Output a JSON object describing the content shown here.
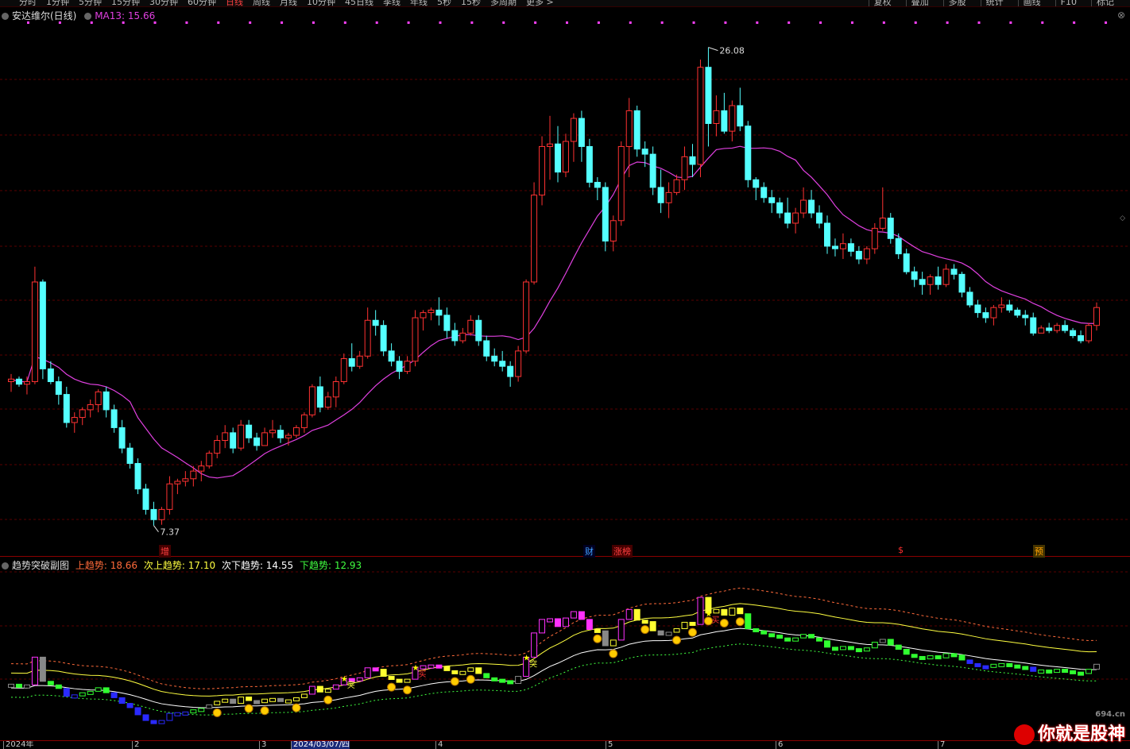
{
  "toolbar": {
    "periods": [
      "分时",
      "1分钟",
      "5分钟",
      "15分钟",
      "30分钟",
      "60分钟",
      "日线",
      "周线",
      "月线",
      "10分钟",
      "45日线",
      "季线",
      "年线",
      "5秒",
      "15秒",
      "多周期",
      "更多 >"
    ],
    "active_period": "日线",
    "right_buttons": [
      "复权",
      "叠加",
      "多股",
      "统计",
      "画线",
      "F10",
      "标记"
    ]
  },
  "main_panel": {
    "stock_name": "安达维尔(日线)",
    "ma_label": "MA13: 15.66",
    "high_label": "26.08",
    "low_label": "7.37"
  },
  "markers": [
    {
      "text": "增",
      "color": "#ff4040",
      "bg": "#400"
    },
    {
      "text": "财",
      "color": "#40a0ff",
      "bg": "#002"
    },
    {
      "text": "涨榜",
      "color": "#ff4040",
      "bg": "#400"
    },
    {
      "text": "$",
      "color": "#ff3030",
      "bg": "#000"
    },
    {
      "text": "预",
      "color": "#ffa000",
      "bg": "#430"
    }
  ],
  "sub_panel": {
    "name": "趋势突破副图",
    "up_label": "上趋势: 18.66",
    "up_color": "#ff6a3a",
    "sub_up_label": "次上趋势: 17.10",
    "sub_up_color": "#ffff40",
    "sub_down_label": "次下趋势: 14.55",
    "sub_down_color": "#ffffff",
    "down_label": "下趋势: 12.93",
    "down_color": "#40ff40",
    "signal_texts": [
      "突",
      "买"
    ]
  },
  "x_axis": {
    "labels": [
      "2024年",
      "2",
      "3",
      "2024/03/07/四",
      "4",
      "5",
      "6",
      "7"
    ],
    "selected": "2024/03/07/四"
  },
  "watermark": {
    "url": "694.cn",
    "text": "你就是股神"
  },
  "colors": {
    "up": "#ff3232",
    "down": "#54ffff",
    "ma": "#e040e0",
    "grid": "#5a0000"
  },
  "chart_data": {
    "type": "candlestick",
    "ma_period": 13,
    "candles": [
      [
        13.0,
        13.3,
        12.6,
        13.1
      ],
      [
        13.1,
        13.2,
        12.8,
        12.9
      ],
      [
        12.9,
        13.2,
        12.5,
        13.0
      ],
      [
        13.0,
        17.5,
        12.9,
        16.9
      ],
      [
        16.9,
        17.0,
        13.1,
        13.5
      ],
      [
        13.5,
        13.8,
        12.9,
        13.0
      ],
      [
        13.0,
        13.2,
        12.1,
        12.5
      ],
      [
        12.5,
        12.8,
        11.2,
        11.4
      ],
      [
        11.4,
        11.8,
        11.0,
        11.6
      ],
      [
        11.6,
        12.0,
        11.3,
        11.9
      ],
      [
        11.9,
        12.3,
        11.6,
        12.1
      ],
      [
        12.1,
        12.7,
        11.8,
        12.6
      ],
      [
        12.6,
        12.8,
        11.6,
        11.9
      ],
      [
        11.9,
        12.1,
        11.0,
        11.2
      ],
      [
        11.2,
        11.5,
        10.2,
        10.4
      ],
      [
        10.4,
        10.6,
        9.6,
        9.8
      ],
      [
        9.8,
        10.0,
        8.6,
        8.8
      ],
      [
        8.8,
        9.0,
        7.8,
        8.0
      ],
      [
        8.0,
        8.3,
        7.37,
        7.6
      ],
      [
        7.6,
        8.1,
        7.4,
        8.0
      ],
      [
        8.0,
        9.3,
        7.8,
        9.0
      ],
      [
        9.0,
        9.2,
        8.6,
        9.1
      ],
      [
        9.1,
        9.5,
        8.9,
        9.2
      ],
      [
        9.2,
        9.7,
        8.9,
        9.5
      ],
      [
        9.5,
        9.9,
        9.1,
        9.7
      ],
      [
        9.7,
        10.3,
        9.6,
        10.2
      ],
      [
        10.2,
        10.9,
        10.0,
        10.7
      ],
      [
        10.7,
        11.3,
        10.4,
        11.0
      ],
      [
        11.0,
        11.2,
        10.2,
        10.4
      ],
      [
        10.4,
        11.5,
        10.3,
        11.3
      ],
      [
        11.3,
        11.5,
        10.6,
        10.8
      ],
      [
        10.8,
        11.0,
        10.3,
        10.5
      ],
      [
        10.5,
        11.2,
        10.5,
        11.0
      ],
      [
        11.0,
        11.5,
        10.8,
        11.1
      ],
      [
        11.1,
        11.3,
        10.6,
        10.8
      ],
      [
        10.8,
        11.0,
        10.5,
        10.9
      ],
      [
        10.9,
        11.3,
        10.8,
        11.2
      ],
      [
        11.2,
        11.8,
        11.0,
        11.7
      ],
      [
        11.7,
        12.9,
        11.6,
        12.8
      ],
      [
        12.8,
        13.2,
        11.8,
        12.0
      ],
      [
        12.0,
        12.6,
        11.9,
        12.4
      ],
      [
        12.4,
        13.2,
        12.0,
        13.0
      ],
      [
        13.0,
        14.1,
        12.9,
        13.9
      ],
      [
        13.9,
        14.5,
        13.4,
        13.6
      ],
      [
        13.6,
        14.2,
        13.5,
        14.0
      ],
      [
        14.0,
        15.9,
        13.9,
        15.4
      ],
      [
        15.4,
        15.8,
        14.8,
        15.2
      ],
      [
        15.2,
        15.4,
        14.0,
        14.2
      ],
      [
        14.2,
        14.5,
        13.6,
        13.8
      ],
      [
        13.8,
        14.0,
        13.1,
        13.4
      ],
      [
        13.4,
        14.0,
        13.3,
        13.8
      ],
      [
        13.8,
        15.8,
        13.6,
        15.5
      ],
      [
        15.5,
        15.8,
        15.0,
        15.7
      ],
      [
        15.7,
        15.9,
        15.4,
        15.8
      ],
      [
        15.8,
        16.3,
        15.2,
        15.6
      ],
      [
        15.6,
        15.9,
        14.7,
        15.0
      ],
      [
        15.0,
        15.3,
        14.4,
        14.6
      ],
      [
        14.6,
        15.1,
        14.5,
        14.9
      ],
      [
        14.9,
        15.6,
        14.8,
        15.4
      ],
      [
        15.4,
        15.6,
        14.4,
        14.6
      ],
      [
        14.6,
        14.8,
        13.8,
        14.0
      ],
      [
        14.0,
        14.3,
        13.6,
        13.8
      ],
      [
        13.8,
        14.2,
        13.4,
        13.6
      ],
      [
        13.6,
        13.8,
        12.8,
        13.2
      ],
      [
        13.2,
        14.4,
        13.0,
        14.2
      ],
      [
        14.2,
        17.0,
        14.1,
        16.9
      ],
      [
        16.9,
        20.8,
        16.8,
        20.3
      ],
      [
        20.3,
        22.6,
        19.9,
        22.2
      ],
      [
        22.2,
        23.4,
        20.9,
        22.3
      ],
      [
        22.3,
        23.0,
        20.8,
        21.2
      ],
      [
        21.2,
        22.7,
        21.0,
        22.4
      ],
      [
        22.4,
        23.5,
        21.6,
        23.3
      ],
      [
        23.3,
        23.6,
        21.6,
        22.2
      ],
      [
        22.2,
        22.5,
        20.6,
        20.8
      ],
      [
        20.8,
        21.0,
        20.1,
        20.6
      ],
      [
        20.6,
        20.8,
        18.1,
        18.5
      ],
      [
        18.5,
        19.5,
        18.1,
        19.3
      ],
      [
        19.3,
        22.4,
        19.1,
        22.2
      ],
      [
        22.2,
        24.1,
        21.0,
        23.6
      ],
      [
        23.6,
        23.8,
        21.8,
        22.1
      ],
      [
        22.1,
        22.4,
        21.4,
        21.9
      ],
      [
        21.9,
        22.2,
        20.3,
        20.6
      ],
      [
        20.6,
        21.3,
        19.6,
        20.0
      ],
      [
        20.0,
        20.8,
        19.4,
        20.4
      ],
      [
        20.4,
        21.1,
        20.3,
        20.9
      ],
      [
        20.9,
        22.2,
        20.5,
        21.8
      ],
      [
        21.8,
        22.3,
        21.0,
        21.5
      ],
      [
        21.5,
        25.6,
        21.0,
        25.3
      ],
      [
        25.3,
        26.08,
        22.2,
        23.1
      ],
      [
        23.1,
        24.2,
        22.6,
        23.6
      ],
      [
        23.6,
        24.3,
        22.7,
        22.8
      ],
      [
        22.8,
        24.0,
        22.4,
        23.8
      ],
      [
        23.8,
        24.5,
        22.8,
        23.0
      ],
      [
        23.0,
        23.2,
        20.6,
        20.9
      ],
      [
        20.9,
        21.0,
        20.1,
        20.6
      ],
      [
        20.6,
        20.8,
        20.0,
        20.2
      ],
      [
        20.2,
        20.5,
        19.6,
        20.0
      ],
      [
        20.0,
        20.2,
        19.4,
        19.6
      ],
      [
        19.6,
        20.2,
        19.0,
        19.2
      ],
      [
        19.2,
        19.8,
        18.8,
        19.6
      ],
      [
        19.6,
        20.6,
        19.4,
        20.1
      ],
      [
        20.1,
        20.5,
        19.4,
        19.6
      ],
      [
        19.6,
        19.9,
        19.0,
        19.2
      ],
      [
        19.2,
        19.5,
        18.0,
        18.3
      ],
      [
        18.3,
        18.6,
        17.9,
        18.2
      ],
      [
        18.2,
        18.8,
        17.8,
        18.4
      ],
      [
        18.4,
        18.6,
        17.9,
        18.1
      ],
      [
        18.1,
        18.3,
        17.6,
        17.8
      ],
      [
        17.8,
        18.3,
        17.6,
        18.2
      ],
      [
        18.2,
        19.2,
        18.0,
        19.0
      ],
      [
        19.0,
        20.6,
        18.9,
        19.4
      ],
      [
        19.4,
        19.6,
        18.4,
        18.6
      ],
      [
        18.6,
        18.8,
        17.8,
        18.0
      ],
      [
        18.0,
        18.2,
        17.2,
        17.3
      ],
      [
        17.3,
        17.5,
        16.7,
        17.0
      ],
      [
        17.0,
        17.3,
        16.4,
        16.8
      ],
      [
        16.8,
        17.2,
        16.4,
        17.1
      ],
      [
        17.1,
        17.5,
        16.6,
        16.8
      ],
      [
        16.8,
        17.6,
        16.7,
        17.4
      ],
      [
        17.4,
        17.6,
        17.0,
        17.2
      ],
      [
        17.2,
        17.3,
        16.3,
        16.5
      ],
      [
        16.5,
        16.7,
        15.9,
        16.0
      ],
      [
        16.0,
        16.2,
        15.5,
        15.7
      ],
      [
        15.7,
        15.9,
        15.3,
        15.5
      ],
      [
        15.5,
        16.0,
        15.2,
        15.9
      ],
      [
        15.9,
        16.3,
        15.7,
        16.0
      ],
      [
        16.0,
        16.2,
        15.7,
        15.8
      ],
      [
        15.8,
        15.9,
        15.5,
        15.6
      ],
      [
        15.6,
        15.8,
        15.2,
        15.5
      ],
      [
        15.5,
        15.7,
        14.8,
        14.9
      ],
      [
        14.9,
        15.2,
        14.9,
        15.1
      ],
      [
        15.1,
        15.3,
        14.9,
        15.0
      ],
      [
        15.0,
        15.3,
        14.9,
        15.2
      ],
      [
        15.2,
        15.4,
        14.9,
        15.0
      ],
      [
        15.0,
        15.1,
        14.7,
        14.8
      ],
      [
        14.8,
        15.0,
        14.5,
        14.6
      ],
      [
        14.6,
        15.3,
        14.5,
        15.2
      ],
      [
        15.2,
        16.1,
        15.0,
        15.9
      ]
    ]
  }
}
